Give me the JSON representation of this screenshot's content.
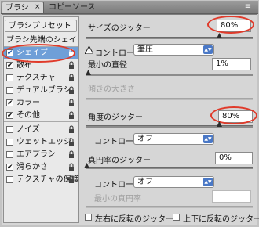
{
  "window": {
    "tabs": [
      {
        "label": "ブラシ",
        "close": "×"
      },
      {
        "label": "コピーソース"
      }
    ],
    "menu_glyph": "≡"
  },
  "left_panel": {
    "preset_button": "ブラシプリセット",
    "section_title": "ブラシ先端のシェイプ",
    "items": [
      {
        "label": "シェイプ",
        "checked": true,
        "selected": true
      },
      {
        "label": "散布",
        "checked": true
      },
      {
        "label": "テクスチャ",
        "checked": false
      },
      {
        "label": "デュアルブラシ",
        "checked": false
      },
      {
        "label": "カラー",
        "checked": true
      },
      {
        "label": "その他",
        "checked": true
      },
      {
        "label": "ノイズ",
        "checked": false
      },
      {
        "label": "ウェットエッジ",
        "checked": false
      },
      {
        "label": "エアブラシ",
        "checked": false
      },
      {
        "label": "滑らかさ",
        "checked": true
      },
      {
        "label": "テクスチャの保護",
        "checked": false
      }
    ]
  },
  "size_jitter": {
    "label": "サイズのジッター",
    "value": "80%",
    "level": 0.8
  },
  "size_control": {
    "label": "コントロール :",
    "value": "筆圧"
  },
  "min_diameter": {
    "label": "最小の直径",
    "value": "1%",
    "level": 0.01
  },
  "tilt_scale": {
    "label": "傾きの大きさ"
  },
  "angle_jitter": {
    "label": "角度のジッター",
    "value": "80%",
    "level": 0.8
  },
  "angle_control": {
    "label": "コントロール :",
    "value": "オフ"
  },
  "roundness_jitter": {
    "label": "真円率のジッター",
    "value": "0%",
    "level": 0.0
  },
  "roundness_control": {
    "label": "コントロール :",
    "value": "オフ"
  },
  "min_roundness": {
    "label": "最小の真円率"
  },
  "flip_x": {
    "label": "左右に反転のジッター",
    "checked": false
  },
  "flip_y": {
    "label": "上下に反転のジッター",
    "checked": false
  },
  "colors": {
    "accent": "#e03a2a",
    "selection": "#6f9fd8"
  }
}
